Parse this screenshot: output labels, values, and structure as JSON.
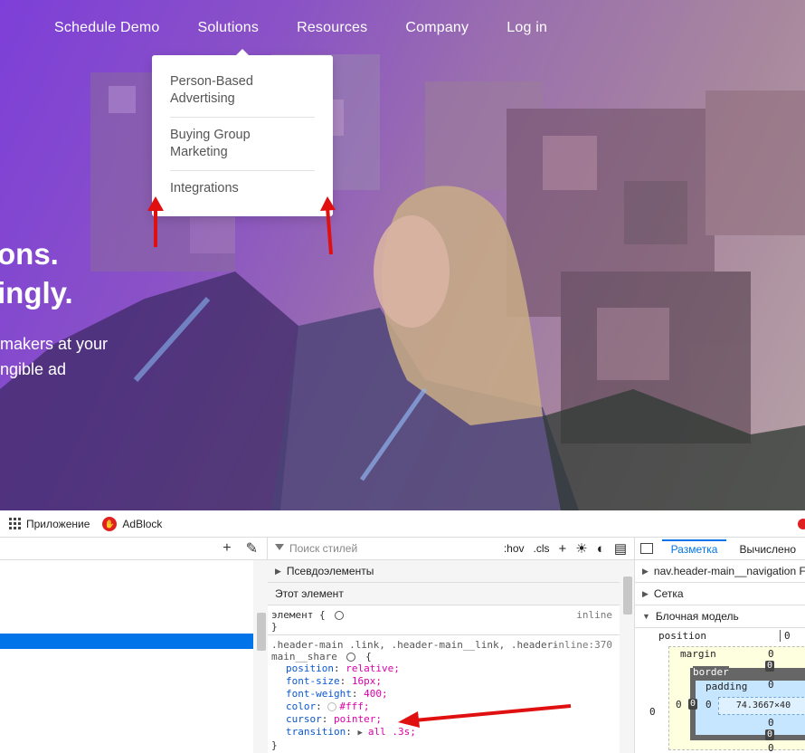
{
  "nav": {
    "items": [
      "Schedule Demo",
      "Solutions",
      "Resources",
      "Company",
      "Log in"
    ]
  },
  "dropdown": {
    "items": [
      "Person-Based\nAdvertising",
      "Buying Group\nMarketing",
      "Integrations"
    ]
  },
  "hero": {
    "line1": "ons.",
    "line2": "ingly.",
    "sub1": "makers at your",
    "sub2": "ngible ad"
  },
  "bookmarks": {
    "apps": "Приложение",
    "adblock": "AdBlock"
  },
  "rules_toolbar": {
    "filter_placeholder": "Поиск стилей",
    "hov": ":hov",
    "cls": ".cls"
  },
  "rules": {
    "pseudo": "Псевдоэлементы",
    "this_element": "Этот элемент",
    "element_selector": "элемент {",
    "inline": "inline",
    "close_brace": "}",
    "selector_line1": ".header-main .link, .header-main__link, .header-",
    "selector_line2": "main__share",
    "selector_open": "{",
    "source": "inline:370",
    "declarations": [
      {
        "prop": "position",
        "val": "relative;"
      },
      {
        "prop": "font-size",
        "val": "16px;"
      },
      {
        "prop": "font-weight",
        "val": "400;"
      },
      {
        "prop": "color",
        "val": "#fff;"
      },
      {
        "prop": "cursor",
        "val": "pointer;"
      },
      {
        "prop": "transition",
        "val": "all .3s;"
      }
    ]
  },
  "layout_panel": {
    "tab_layout": "Разметка",
    "tab_computed": "Вычислено",
    "flex_item": "nav.header-main__navigation Fl",
    "grid": "Сетка",
    "box_model": "Блочная модель",
    "position_label": "position",
    "position_val": "0",
    "margin_label": "margin",
    "border_label": "border",
    "padding_label": "padding",
    "margin_top": "0",
    "border_top": "0",
    "padding_top": "0",
    "content_size": "74.3667×40",
    "left_outer": "0",
    "left_margin": "0",
    "left_border": "0",
    "left_padding": "0",
    "padding_bottom": "0",
    "border_bottom": "0",
    "margin_bottom": "0"
  },
  "colors": {
    "accent": "#0074e8",
    "hero_purple": "#7d3fd8",
    "annotation_red": "#e01010"
  }
}
